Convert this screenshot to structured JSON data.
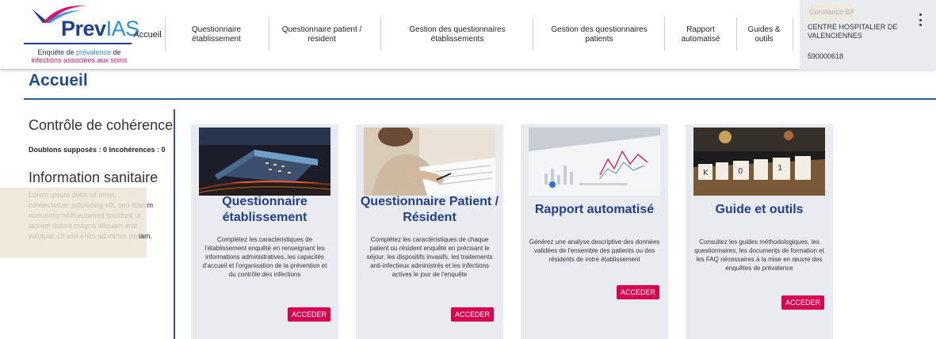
{
  "logo": {
    "word_prev": "Prev",
    "word_ias": "IAS",
    "sub_line1_a": "Enquête de ",
    "sub_line1_b": "prévalence",
    "sub_line1_c": " de",
    "sub_line2": "infections associées aux soins"
  },
  "nav": {
    "accueil": "Accueil",
    "items": [
      {
        "line1": "Questionnaire",
        "line2": "établissement"
      },
      {
        "line1": "Questionnaire patient /",
        "line2": "resident"
      },
      {
        "line1": "Gestion des questionnaires",
        "line2": "établissements"
      },
      {
        "line1": "Gestion des questionnaires",
        "line2": "patients"
      },
      {
        "line1": "Rapport",
        "line2": "automatisé"
      },
      {
        "line1": "Guides &",
        "line2": "outils"
      }
    ]
  },
  "user": {
    "name": "Constance BAI",
    "org_line1": "CENTRE HOSPITALIER DE",
    "org_line2": "VALENCIENNES",
    "id": "590000618"
  },
  "page": {
    "title": "Accueil"
  },
  "left": {
    "coherence_title": "Contrôle de cohérence",
    "stats": "Doublons supposés : 0 Incohérences : 0",
    "info_title": "Information sanitaire",
    "lorem_lines": [
      {
        "light": "Lorem ipsum dolor sit amet,",
        "dark": ""
      },
      {
        "light": "consectetuer adipiscing elit, sed diam",
        "dark": ""
      },
      {
        "light": "nonummy nibh euismod tincidunt ut",
        "dark": ""
      },
      {
        "light": "laoreet dolore magna aliquam erat",
        "dark": ""
      },
      {
        "light": "volutpat. Ut wisi enim ad minim ver",
        "dark": "iam."
      }
    ],
    "lorem_tail_1": "m",
    "lorem_tail_2": "ut"
  },
  "cards": [
    {
      "title": "Questionnaire établissement",
      "desc": "Complétez les caractéristiques de l'établissement enquêté en renseignant les informations administratives, les capacités d'accueil et l'organisation de la prévention et du contrôle des infections",
      "button": "ACCEDER"
    },
    {
      "title": "Questionnaire Patient / Résident",
      "desc": "Complétez les caractéristiques de chaque patient ou résident enquêté en précisant le séjour, les dispositifs invasifs, les traitements anti-infectieux administrés et les infections actives le jour de l'enquête",
      "button": "ACCEDER"
    },
    {
      "title": "Rapport automatisé",
      "desc": "Générez une analyse descriptive des données validées de l'ensemble des patients ou des résidents de votre établissement",
      "button": "ACCEDER"
    },
    {
      "title": "Guide et outils",
      "desc": "Consultez les guides méthodologiques, les questionnaires, les documents de formation et les FAQ nécessaires à la mise en œuvre des enquêtes de prévalence",
      "button": "ACCEDER"
    }
  ],
  "colors": {
    "brand_dark": "#1f3f8f",
    "brand_light": "#2c8fd6",
    "accent": "#d9044f",
    "card_bg": "#e9ebf0"
  }
}
